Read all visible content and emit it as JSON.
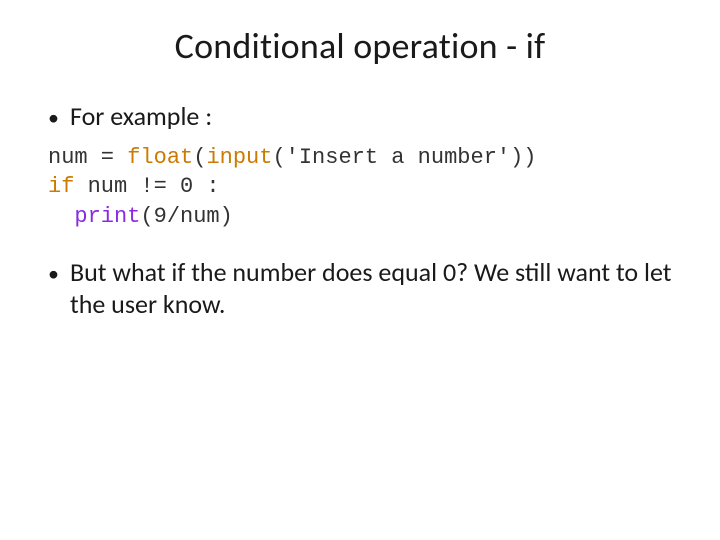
{
  "title": "Conditional operation - if",
  "bullet1": "For example :",
  "code": {
    "l1_a": "num = ",
    "l1_float": "float",
    "l1_b": "(",
    "l1_input": "input",
    "l1_c": "(",
    "l1_str": "'Insert a number'",
    "l1_d": "))",
    "l2_if": "if",
    "l2_rest": " num != 0 :",
    "l3_indent": "  ",
    "l3_print": "print",
    "l3_rest": "(9/num)"
  },
  "bullet2": "But what if the number does equal 0? We still want to let the user know."
}
